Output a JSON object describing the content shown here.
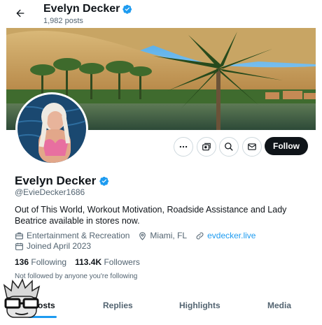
{
  "header": {
    "name": "Evelyn Decker",
    "posts": "1,982 posts"
  },
  "profile": {
    "name": "Evelyn Decker",
    "handle": "@EvieDecker1686",
    "bio": "Out of This World, Workout Motivation, Roadside Assistance and Lady Beatrice available in stores now.",
    "category": "Entertainment & Recreation",
    "location": "Miami, FL",
    "website": "evdecker.live",
    "joined": "Joined April 2023",
    "following_count": "136",
    "following_label": "Following",
    "followers_count": "113.4K",
    "followers_label": "Followers",
    "not_followed": "Not followed by anyone you're following"
  },
  "actions": {
    "follow_label": "Follow",
    "icons": [
      "more-icon",
      "subscribe-icon",
      "search-icon",
      "message-icon"
    ]
  },
  "tabs": [
    {
      "label": "Posts",
      "active": true
    },
    {
      "label": "Replies",
      "active": false
    },
    {
      "label": "Highlights",
      "active": false
    },
    {
      "label": "Media",
      "active": false
    }
  ],
  "colors": {
    "accent": "#1d9bf0",
    "text": "#0f1419",
    "secondary": "#536471",
    "follow_bg": "#0f1419"
  }
}
